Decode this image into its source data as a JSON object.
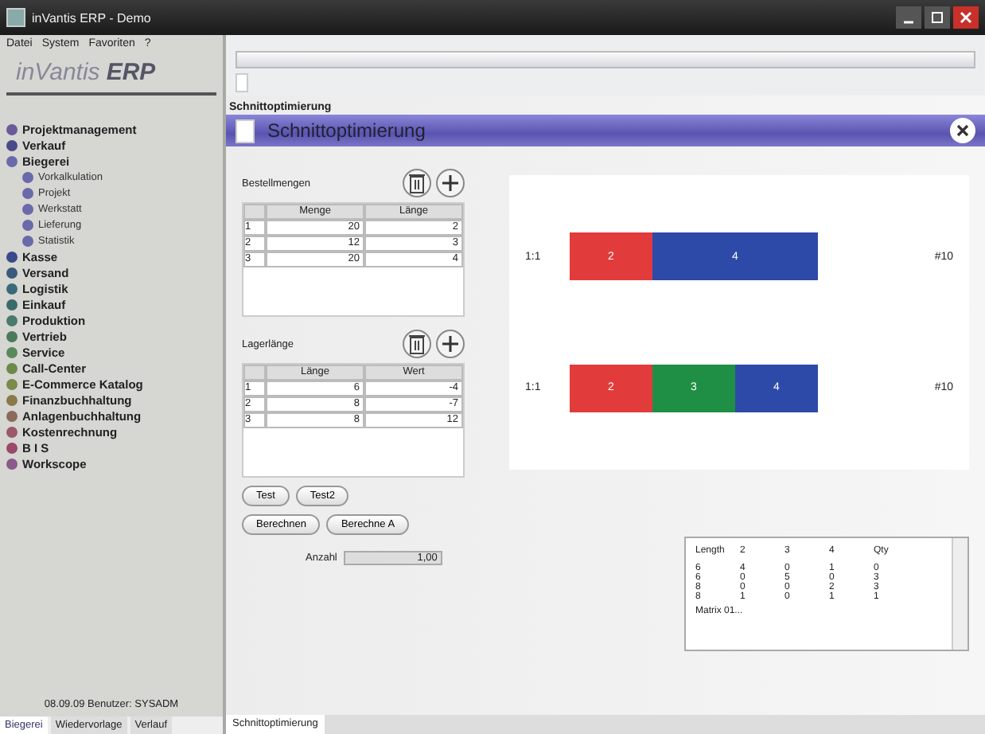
{
  "window": {
    "title": "inVantis ERP - Demo"
  },
  "menu": [
    "Datei",
    "System",
    "Favoriten",
    "?"
  ],
  "logo": {
    "text": "inVantis",
    "suffix": "ERP"
  },
  "sidebar": {
    "items": [
      {
        "label": "Projektmanagement",
        "color": "#6a5a9a"
      },
      {
        "label": "Verkauf",
        "color": "#4a4a8a"
      },
      {
        "label": "Biegerei",
        "color": "#6a6aaa",
        "children": [
          {
            "label": "Vorkalkulation"
          },
          {
            "label": "Projekt"
          },
          {
            "label": "Werkstatt"
          },
          {
            "label": "Lieferung"
          },
          {
            "label": "Statistik"
          }
        ]
      },
      {
        "label": "Kasse",
        "color": "#3a4a8a"
      },
      {
        "label": "Versand",
        "color": "#3a5a7a"
      },
      {
        "label": "Logistik",
        "color": "#3a6a7a"
      },
      {
        "label": "Einkauf",
        "color": "#3a6a6a"
      },
      {
        "label": "Produktion",
        "color": "#4a7a6a"
      },
      {
        "label": "Vertrieb",
        "color": "#4a7a5a"
      },
      {
        "label": "Service",
        "color": "#5a8a5a"
      },
      {
        "label": "Call-Center",
        "color": "#6a8a4a"
      },
      {
        "label": "E-Commerce Katalog",
        "color": "#7a8a4a"
      },
      {
        "label": "Finanzbuchhaltung",
        "color": "#8a7a4a"
      },
      {
        "label": "Anlagenbuchhaltung",
        "color": "#8a6a5a"
      },
      {
        "label": "Kostenrechnung",
        "color": "#9a5a6a"
      },
      {
        "label": "B I S",
        "color": "#9a4a6a"
      },
      {
        "label": "Workscope",
        "color": "#8a5a8a"
      }
    ],
    "status": "08.09.09 Benutzer: SYSADM",
    "tabs": [
      {
        "label": "Biegerei",
        "selected": true
      },
      {
        "label": "Wiedervorlage",
        "selected": false
      },
      {
        "label": "Verlauf",
        "selected": false
      }
    ]
  },
  "breadcrumb": "Schnittoptimierung",
  "panel_title": "Schnittoptimierung",
  "orders": {
    "label": "Bestellmengen",
    "columns": [
      "Menge",
      "Länge"
    ],
    "rows": [
      [
        "1",
        "20",
        "2"
      ],
      [
        "2",
        "12",
        "3"
      ],
      [
        "3",
        "20",
        "4"
      ]
    ]
  },
  "stock": {
    "label": "Lagerlänge",
    "columns": [
      "Länge",
      "Wert"
    ],
    "rows": [
      [
        "1",
        "6",
        "-4"
      ],
      [
        "2",
        "8",
        "-7"
      ],
      [
        "3",
        "8",
        "12"
      ]
    ]
  },
  "buttons": [
    [
      "Test",
      "Test2"
    ],
    [
      "Berechnen",
      "Berechne A"
    ]
  ],
  "count": {
    "label": "Anzahl",
    "value": "1,00"
  },
  "bars": [
    {
      "label": "1:1",
      "total": "#10",
      "segments": [
        {
          "text": "2",
          "color": "#e23b3b"
        },
        {
          "text": "4",
          "color": "#2d4aa8"
        }
      ]
    },
    {
      "label": "1:1",
      "total": "#10",
      "segments": [
        {
          "text": "2",
          "color": "#e23b3b"
        },
        {
          "text": "3",
          "color": "#1f8f45"
        },
        {
          "text": "4",
          "color": "#2d4aa8"
        }
      ]
    }
  ],
  "output": {
    "header": [
      "Length",
      "2",
      "3",
      "4",
      "Qty"
    ],
    "rows": [
      [
        "6",
        "4",
        "0",
        "1",
        "0"
      ],
      [
        "6",
        "0",
        "5",
        "0",
        "3"
      ],
      [
        "8",
        "0",
        "0",
        "2",
        "3"
      ],
      [
        "8",
        "1",
        "0",
        "1",
        "1"
      ]
    ],
    "footer": "Matrix 01..."
  },
  "bottom_tabs": [
    {
      "label": "Schnittoptimierung",
      "selected": true
    }
  ]
}
